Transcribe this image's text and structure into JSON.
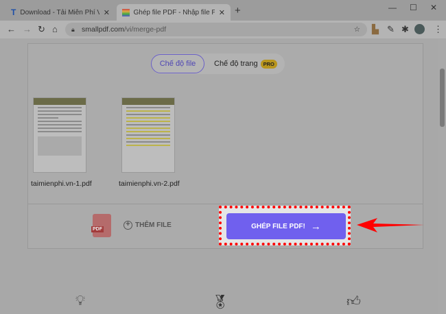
{
  "browser": {
    "tabs": [
      {
        "label": "Download - Tải Miễn Phí VN - Ph",
        "icon": "T"
      },
      {
        "label": "Ghép file PDF - Nhập file PDF trự",
        "icon": "smallpdf-icon"
      }
    ],
    "url_host": "smallpdf.com",
    "url_path": "/vi/merge-pdf"
  },
  "mode": {
    "file": "Chế độ file",
    "page": "Chế độ trang",
    "pro": "PRO"
  },
  "files": [
    {
      "name": "taimienphi.vn-1.pdf"
    },
    {
      "name": "taimienphi.vn-2.pdf"
    }
  ],
  "actions": {
    "add_file": "THÊM FILE",
    "merge": "GHÉP FILE PDF!",
    "pdf_badge": "PDF"
  },
  "colors": {
    "accent": "#7060ee",
    "highlight": "#ff0000"
  }
}
